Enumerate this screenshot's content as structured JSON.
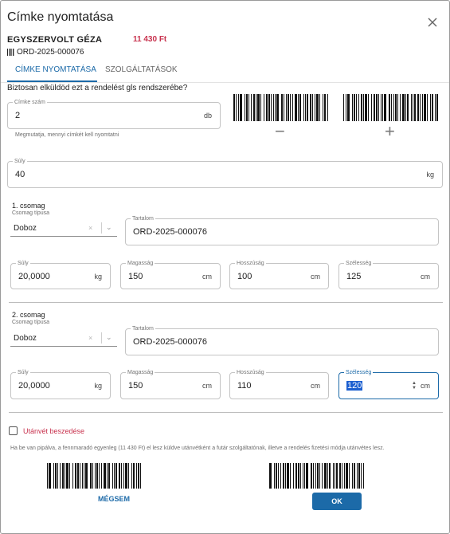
{
  "dialog": {
    "title": "Címke nyomtatása",
    "close_icon": "close-icon"
  },
  "header": {
    "customer": "EGYSZERVOLT GÉZA",
    "price": "11 430 Ft",
    "order_icon": "barcode-icon",
    "order_id": "ORD-2025-000076"
  },
  "tabs": [
    {
      "label": "CÍMKE NYOMTATÁSA",
      "active": true
    },
    {
      "label": "SZOLGÁLTATÁSOK",
      "active": false
    }
  ],
  "question": "Biztosan elküldöd ezt a rendelést gls rendszerébe?",
  "label_count": {
    "label": "Címke szám",
    "value": "2",
    "unit": "db",
    "helper": "Megmutatja, mennyi címkét kell nyomtatni",
    "decrement_label": "−",
    "increment_label": "+"
  },
  "weight": {
    "label": "Súly",
    "value": "40",
    "unit": "kg"
  },
  "packages": [
    {
      "title": "1. csomag",
      "type_label": "Csomag típusa",
      "type_value": "Doboz",
      "content_label": "Tartalom",
      "content_value": "ORD-2025-000076",
      "weight_label": "Súly",
      "weight_value": "20,0000",
      "weight_unit": "kg",
      "height_label": "Magasság",
      "height_value": "150",
      "height_unit": "cm",
      "length_label": "Hosszúság",
      "length_value": "100",
      "length_unit": "cm",
      "width_label": "Szélesség",
      "width_value": "125",
      "width_unit": "cm"
    },
    {
      "title": "2. csomag",
      "type_label": "Csomag típusa",
      "type_value": "Doboz",
      "content_label": "Tartalom",
      "content_value": "ORD-2025-000076",
      "weight_label": "Súly",
      "weight_value": "20,0000",
      "weight_unit": "kg",
      "height_label": "Magasság",
      "height_value": "150",
      "height_unit": "cm",
      "length_label": "Hosszúság",
      "length_value": "110",
      "length_unit": "cm",
      "width_label": "Szélesség",
      "width_value": "120",
      "width_unit": "cm"
    }
  ],
  "select_clear": "×",
  "select_chevron": "⌄",
  "cod": {
    "checked": false,
    "label": "Utánvét beszedése",
    "note": "Ha be van pipálva, a fennmaradó egyenleg (11 430 Ft) el lesz küldve utánvétként a futár szolgáltatónak, illetve a rendelés fizetési módja utánvétes lesz."
  },
  "actions": {
    "cancel": "MÉGSEM",
    "ok": "OK"
  },
  "colors": {
    "accent": "#1c6aa8",
    "price": "#c8324e"
  }
}
